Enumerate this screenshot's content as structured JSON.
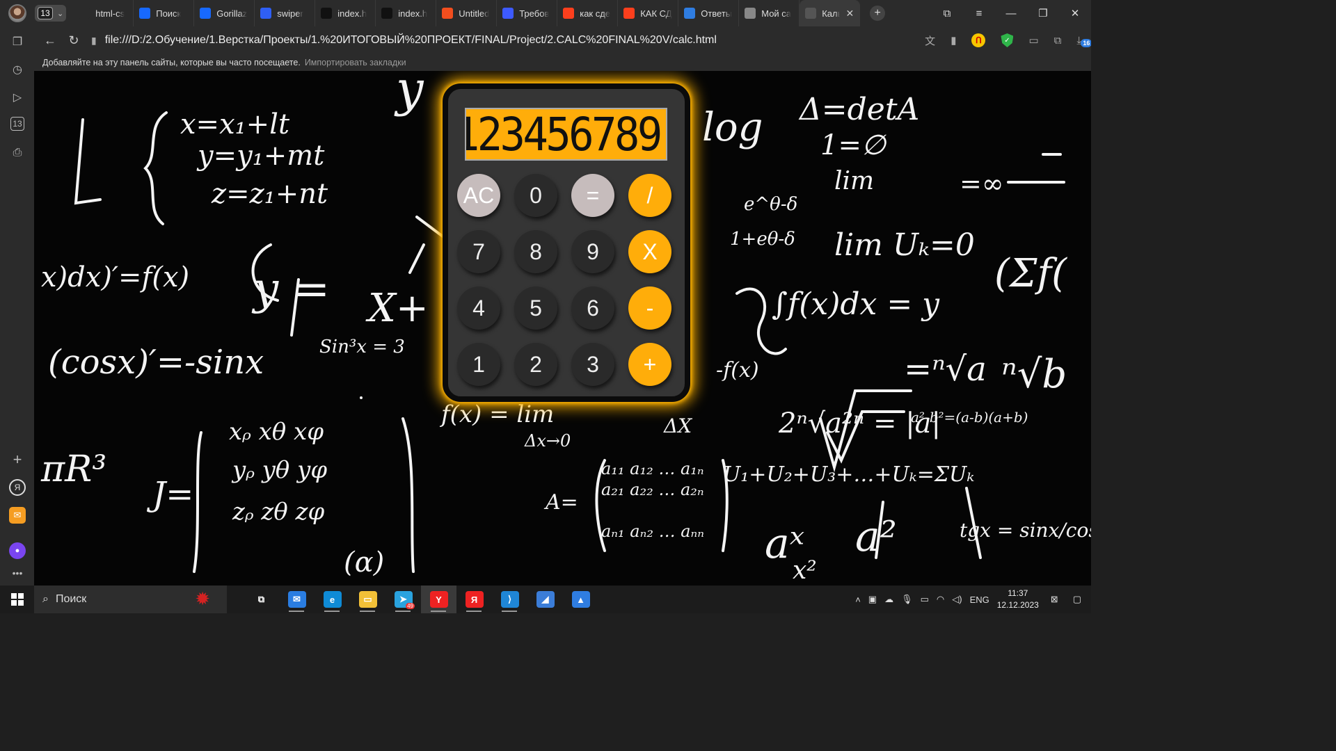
{
  "browser": {
    "tab_count": "13",
    "tabs": [
      {
        "label": "html-cs",
        "icon": "github-icon",
        "color": "#2b2b2b"
      },
      {
        "label": "Поиск",
        "icon": "behance-icon",
        "color": "#1769ff"
      },
      {
        "label": "Gorillaz",
        "icon": "behance-icon",
        "color": "#1769ff"
      },
      {
        "label": "swiper",
        "icon": "swiper-icon",
        "color": "#2f5ff5"
      },
      {
        "label": "index.h",
        "icon": "codepen-icon",
        "color": "#111111"
      },
      {
        "label": "index.h",
        "icon": "codepen-icon",
        "color": "#111111"
      },
      {
        "label": "Untitled",
        "icon": "figma-icon",
        "color": "#f24e1e"
      },
      {
        "label": "Требов",
        "icon": "translate-icon",
        "color": "#3d5afe"
      },
      {
        "label": "как сде",
        "icon": "yandex-icon",
        "color": "#fc3f1d"
      },
      {
        "label": "КАК СД",
        "icon": "yandex-icon",
        "color": "#fc3f1d"
      },
      {
        "label": "Ответы",
        "icon": "question-icon",
        "color": "#2f7de1"
      },
      {
        "label": "Мой са",
        "icon": "file-icon",
        "color": "#888888"
      },
      {
        "label": "Кальк",
        "icon": "calculator-icon",
        "color": "#555555",
        "active": true
      }
    ],
    "url": "file:///D:/2.Обучение/1.Верстка/Проекты/1.%20ИТОГОВЫЙ%20ПРОЕКТ/FINAL/Project/2.CALC%20FINAL%20V/calc.html",
    "bookmarks_hint": "Добавляйте на эту панель сайты, которые вы часто посещаете.",
    "bookmarks_import": "Импортировать закладки",
    "downloads_badge": "16"
  },
  "calculator": {
    "display": "123456789",
    "keys": [
      {
        "label": "AC",
        "style": "light"
      },
      {
        "label": "0",
        "style": "dark"
      },
      {
        "label": "=",
        "style": "light"
      },
      {
        "label": "/",
        "style": "op"
      },
      {
        "label": "7",
        "style": "dark"
      },
      {
        "label": "8",
        "style": "dark"
      },
      {
        "label": "9",
        "style": "dark"
      },
      {
        "label": "X",
        "style": "op"
      },
      {
        "label": "4",
        "style": "dark"
      },
      {
        "label": "5",
        "style": "dark"
      },
      {
        "label": "6",
        "style": "dark"
      },
      {
        "label": "-",
        "style": "op"
      },
      {
        "label": "1",
        "style": "dark"
      },
      {
        "label": "2",
        "style": "dark"
      },
      {
        "label": "3",
        "style": "dark"
      },
      {
        "label": "+",
        "style": "op"
      }
    ],
    "accent": "#ffad0a",
    "body": "#353535"
  },
  "taskbar": {
    "search_label": "Поиск",
    "apps": [
      {
        "name": "task-view-icon",
        "glyph": "⧉",
        "color": "transparent"
      },
      {
        "name": "mail-icon",
        "glyph": "✉",
        "color": "#2a7de1"
      },
      {
        "name": "edge-icon",
        "glyph": "e",
        "color": "#0f8bd6"
      },
      {
        "name": "explorer-icon",
        "glyph": "▭",
        "color": "#f2c037"
      },
      {
        "name": "telegram-icon",
        "glyph": "➤",
        "color": "#2aa3df",
        "badge": "49"
      },
      {
        "name": "yandex-browser-icon",
        "glyph": "Y",
        "color": "#e22",
        "active": true
      },
      {
        "name": "yandex-icon",
        "glyph": "Я",
        "color": "#e22"
      },
      {
        "name": "vscode-icon",
        "glyph": "⟩",
        "color": "#1f86d6"
      },
      {
        "name": "app-icon",
        "glyph": "◢",
        "color": "#3b7dd8"
      },
      {
        "name": "photos-icon",
        "glyph": "▲",
        "color": "#2f7de1"
      }
    ],
    "language": "ENG",
    "time": "11:37",
    "date": "12.12.2023"
  }
}
